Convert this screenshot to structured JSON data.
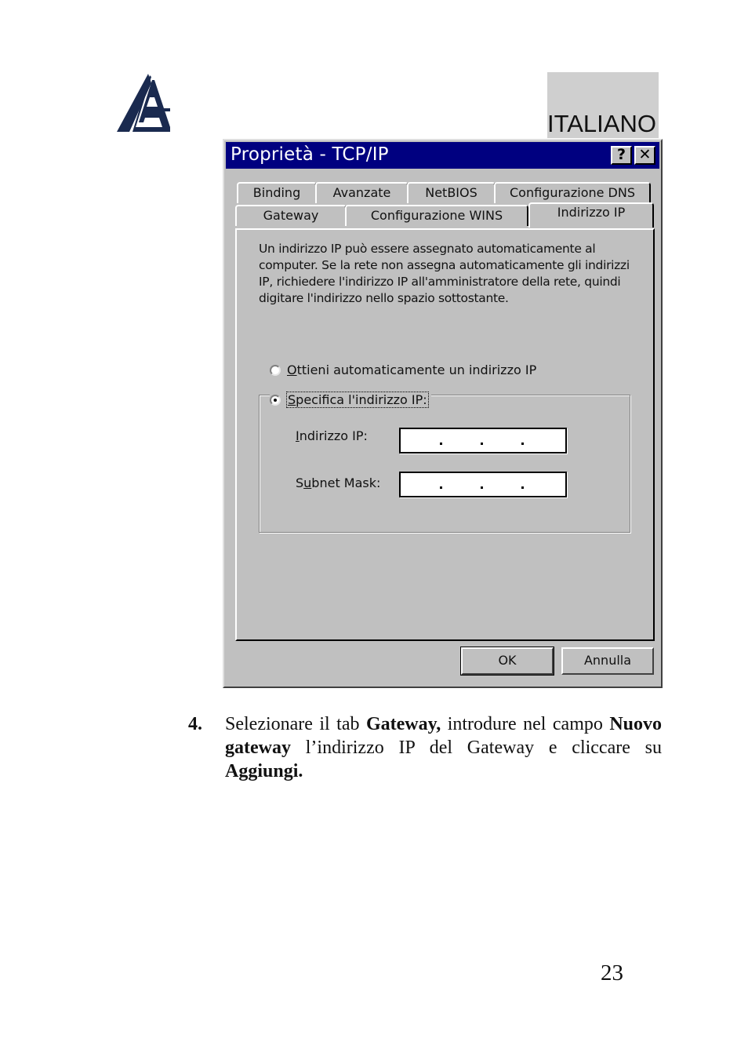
{
  "header": {
    "logo_icon": "atlantis-sailboat-logo",
    "language_label": "ITALIANO"
  },
  "dialog": {
    "title": "Proprietà - TCP/IP",
    "help_button": "?",
    "close_button": "✕",
    "tabs_row1": [
      {
        "label": "Binding"
      },
      {
        "label": "Avanzate"
      },
      {
        "label": "NetBIOS"
      },
      {
        "label": "Configurazione DNS"
      }
    ],
    "tabs_row2": [
      {
        "label": "Gateway"
      },
      {
        "label": "Configurazione WINS"
      },
      {
        "label": "Indirizzo IP",
        "active": true
      }
    ],
    "description": "Un indirizzo IP può essere assegnato automaticamente al computer. Se la rete non assegna automaticamente gli indirizzi IP, richiedere l'indirizzo IP all'amministratore della rete, quindi digitare l'indirizzo nello spazio sottostante.",
    "radio_auto": {
      "accel": "O",
      "rest": "ttieni automaticamente un indirizzo IP",
      "checked": false
    },
    "radio_specify": {
      "accel": "S",
      "rest": "pecifica l'indirizzo IP:",
      "checked": true
    },
    "ip_address": {
      "accel": "I",
      "rest": "ndirizzo IP:",
      "value": ". . ."
    },
    "subnet_mask": {
      "pre": "S",
      "accel": "u",
      "rest": "bnet Mask:",
      "value": ". . ."
    },
    "ok_label": "OK",
    "cancel_label": "Annulla"
  },
  "instructions": {
    "step_number": "4.",
    "parts": [
      {
        "text": "Selezionare il tab ",
        "bold": false
      },
      {
        "text": "Gateway,",
        "bold": true
      },
      {
        "text": " introdure nel campo ",
        "bold": false
      },
      {
        "text": "Nuovo gateway",
        "bold": true
      },
      {
        "text": " l’indirizzo IP del Gateway e cliccare su ",
        "bold": false
      },
      {
        "text": "Aggiungi.",
        "bold": true
      }
    ]
  },
  "page_number": "23"
}
